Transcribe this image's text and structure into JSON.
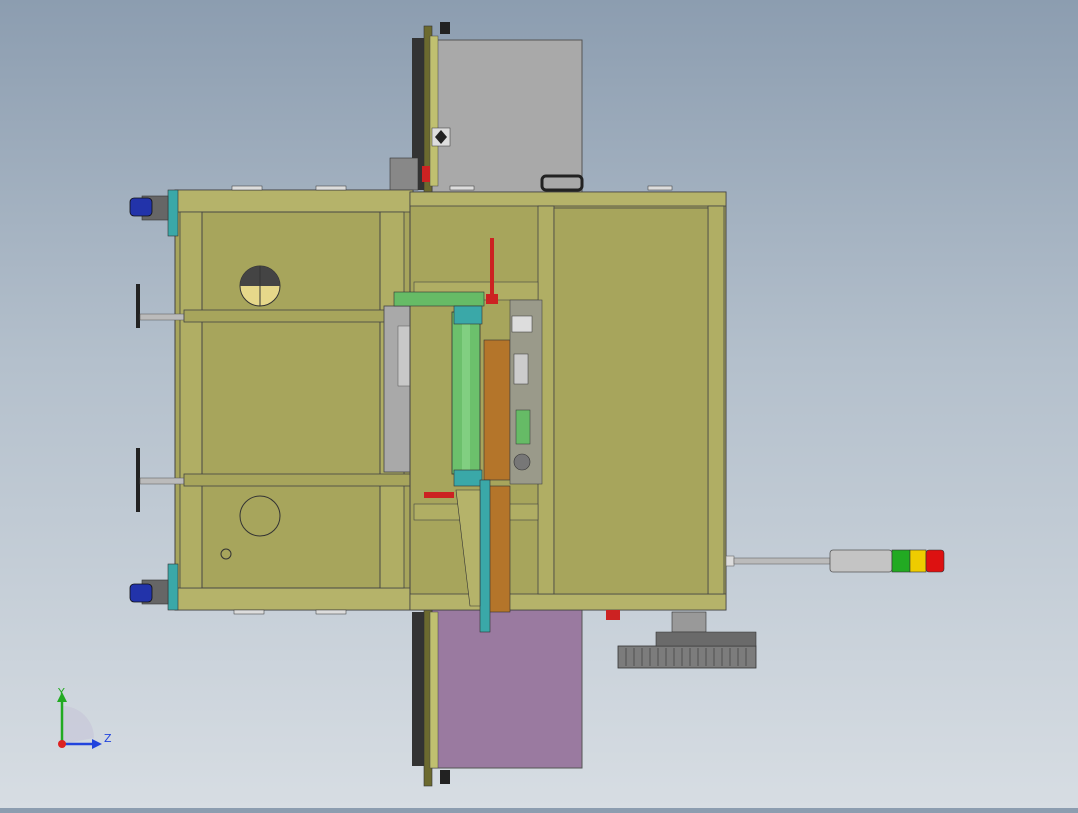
{
  "viewport": {
    "model": "machine-assembly-right-view"
  },
  "triad": {
    "x_label": "Y",
    "z_label": "Z"
  },
  "colors": {
    "frame_olive": "#a7a55c",
    "frame_dark": "#6c6a2f",
    "panel_gray": "#a9a9a9",
    "panel_purple": "#9a7aa0",
    "roller_green": "#66bb66",
    "brown_block": "#b4752a",
    "teal": "#3aa8a8",
    "caster_blue": "#2233aa",
    "tower_red": "#dd1111",
    "tower_yellow": "#eecc00",
    "tower_green": "#22aa22",
    "axis_y": "#22aa22",
    "axis_z": "#2244dd",
    "axis_x": "#dd2222"
  }
}
